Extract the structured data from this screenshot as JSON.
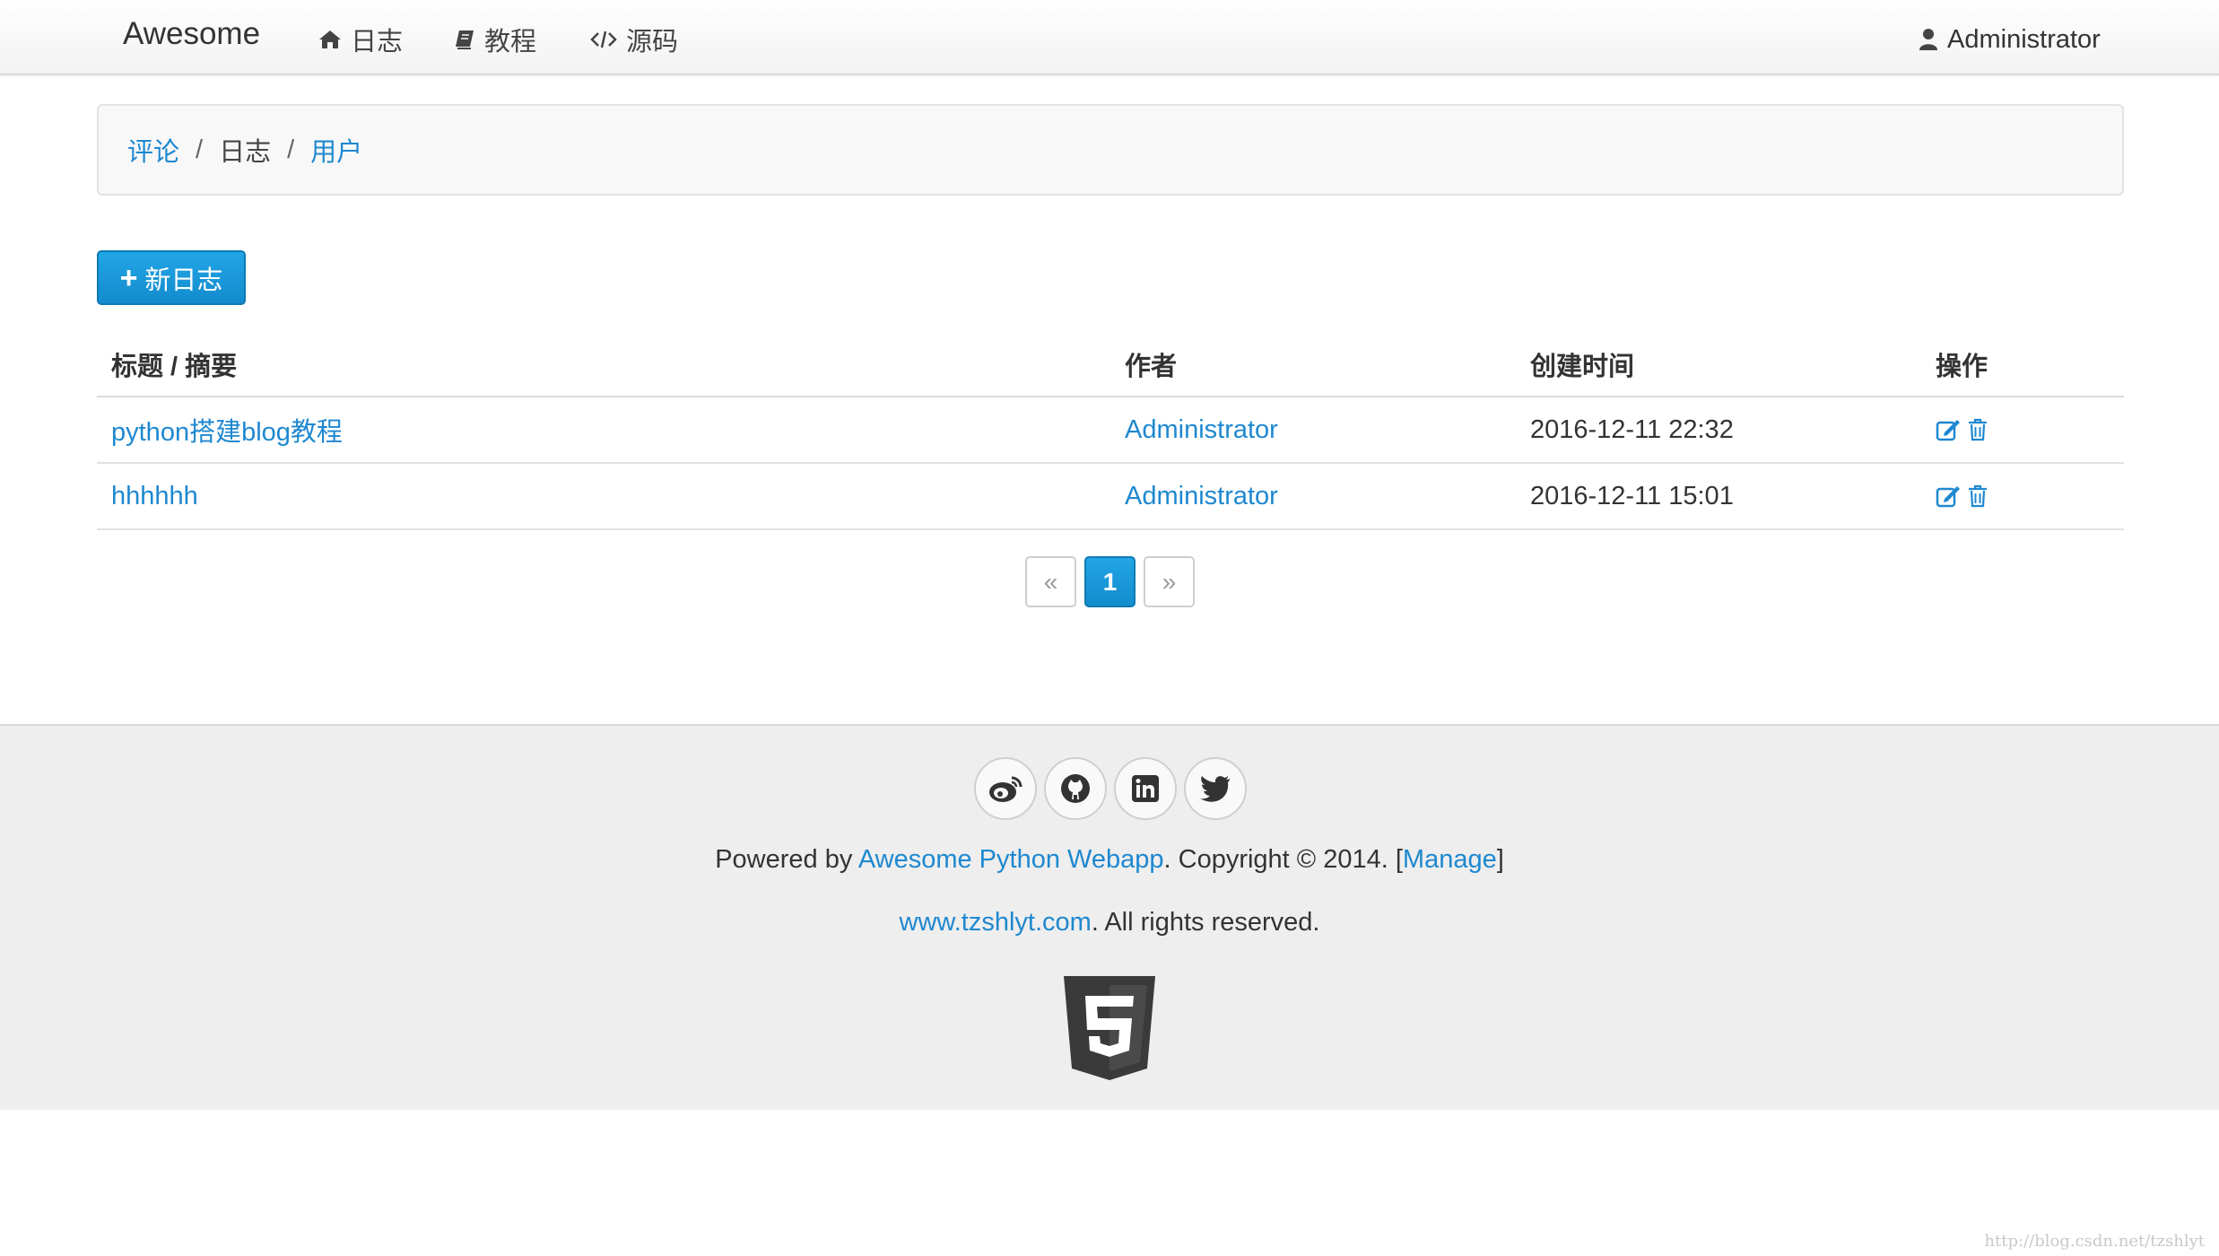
{
  "navbar": {
    "brand": "Awesome",
    "items": [
      {
        "label": "日志",
        "icon": "home-icon"
      },
      {
        "label": "教程",
        "icon": "book-icon"
      },
      {
        "label": "源码",
        "icon": "code-icon"
      }
    ],
    "user": {
      "label": "Administrator",
      "icon": "user-icon"
    }
  },
  "breadcrumb": {
    "items": [
      {
        "label": "评论",
        "link": true
      },
      {
        "label": "日志",
        "link": false
      },
      {
        "label": "用户",
        "link": true
      }
    ],
    "separator": "/"
  },
  "toolbar": {
    "new_blog_label": "新日志"
  },
  "table": {
    "headers": [
      "标题 / 摘要",
      "作者",
      "创建时间",
      "操作"
    ],
    "rows": [
      {
        "title": "python搭建blog教程",
        "author": "Administrator",
        "created": "2016-12-11 22:32"
      },
      {
        "title": "hhhhhh",
        "author": "Administrator",
        "created": "2016-12-11 15:01"
      }
    ]
  },
  "pagination": {
    "prev": "«",
    "current": "1",
    "next": "»"
  },
  "footer": {
    "social_icons": [
      "weibo-icon",
      "github-icon",
      "linkedin-icon",
      "twitter-icon"
    ],
    "powered_prefix": "Powered by ",
    "powered_link": "Awesome Python Webapp",
    "copyright": ". Copyright © 2014. [",
    "manage_link": "Manage",
    "copyright_end": "]",
    "site_link": "www.tzshlyt.com",
    "rights": ". All rights reserved."
  },
  "watermark": "http://blog.csdn.net/tzshlyt",
  "colors": {
    "link": "#1e88d0",
    "primary": "#1a99db",
    "footer_bg": "#eeeeee"
  }
}
